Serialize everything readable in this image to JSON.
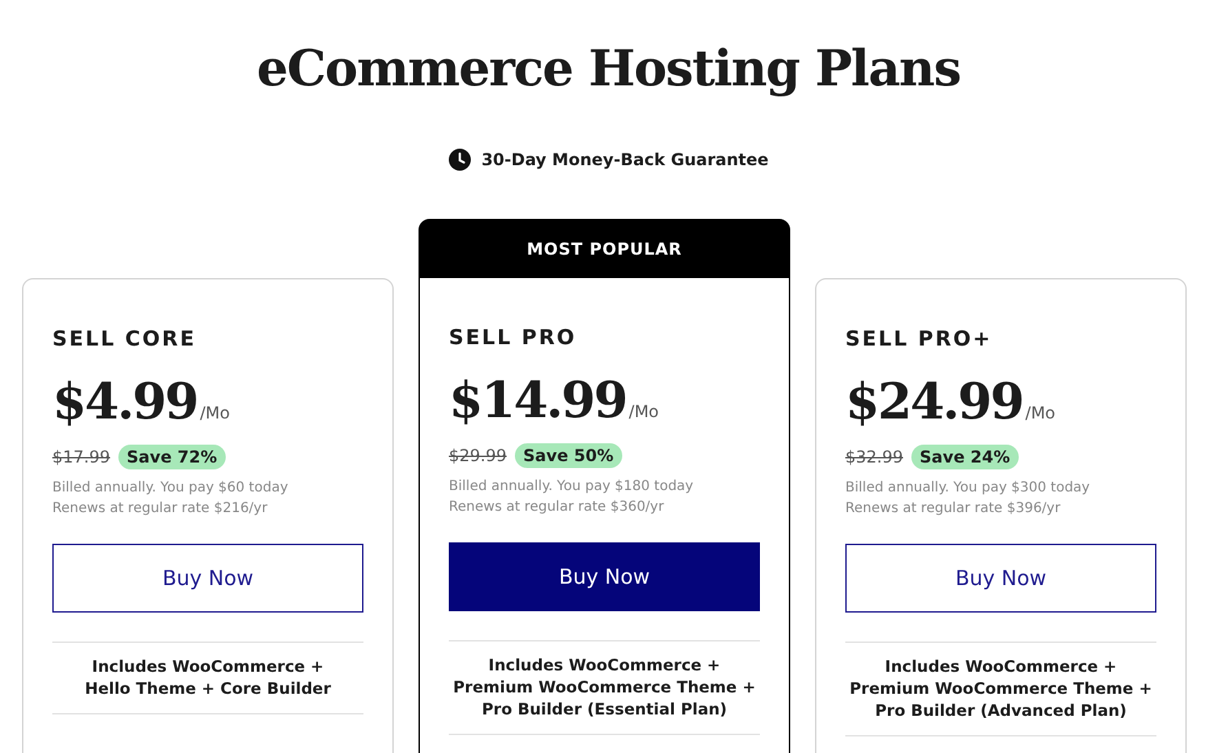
{
  "title": "eCommerce Hosting Plans",
  "guarantee": "30-Day Money-Back Guarantee",
  "plans": [
    {
      "name": "SELL CORE",
      "featured": false,
      "price": "$4.99",
      "period": "/Mo",
      "old_price": "$17.99",
      "save": "Save 72%",
      "billing": "Billed annually. You pay $60 today",
      "renewal": "Renews at regular rate $216/yr",
      "button": "Buy Now",
      "includes": "Includes WooCommerce +\nHello Theme + Core Builder"
    },
    {
      "name": "SELL PRO",
      "featured": true,
      "badge": "MOST POPULAR",
      "price": "$14.99",
      "period": "/Mo",
      "old_price": "$29.99",
      "save": "Save 50%",
      "billing": "Billed annually. You pay $180 today",
      "renewal": "Renews at regular rate $360/yr",
      "button": "Buy Now",
      "includes": "Includes WooCommerce +\nPremium WooCommerce Theme +\nPro Builder (Essential Plan)"
    },
    {
      "name": "SELL PRO+",
      "featured": false,
      "price": "$24.99",
      "period": "/Mo",
      "old_price": "$32.99",
      "save": "Save 24%",
      "billing": "Billed annually. You pay $300 today",
      "renewal": "Renews at regular rate $396/yr",
      "button": "Buy Now",
      "includes": "Includes WooCommerce +\nPremium WooCommerce Theme +\nPro Builder (Advanced Plan)"
    }
  ]
}
